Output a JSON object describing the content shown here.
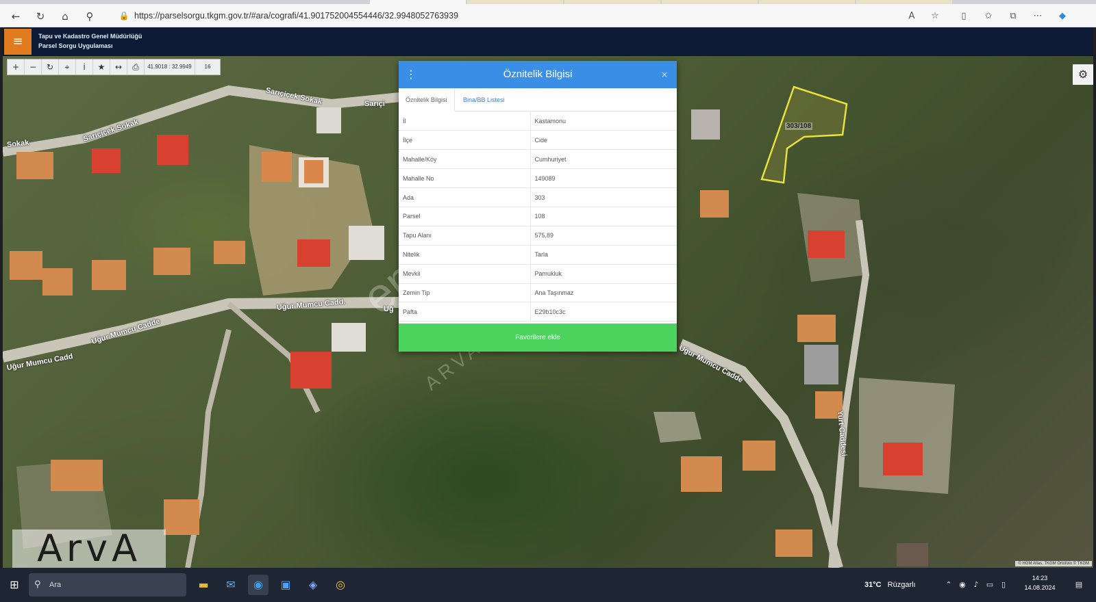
{
  "browser": {
    "url": "https://parselsorgu.tkgm.gov.tr/#ara/cografi/41.901752004554446/32.9948052763939",
    "icons": [
      "back-icon",
      "refresh-icon",
      "home-icon",
      "search-icon",
      "lock-icon",
      "read-aloud-icon",
      "favorite-star-icon",
      "split-view-icon",
      "favorites-icon",
      "collections-icon",
      "more-icon",
      "copilot-icon"
    ]
  },
  "app": {
    "menu_icon": "≡",
    "title_line1": "Tapu ve Kadastro Genel Müdürlüğü",
    "title_line2": "Parsel Sorgu Uygulaması"
  },
  "map": {
    "toolbar": {
      "coords": "41.9018 : 32.9949",
      "zoom": "16"
    },
    "road_labels": {
      "sanguj1": "Sarıçiçek Sokak",
      "sanguj2": "Sarıçiçek Sokak",
      "sanguj3": "Sarıçi",
      "sokak": "Sokak",
      "mumcu1": "Uğur Mumcu Cadd.",
      "mumcu2": "Uğur Mumcu Cadde",
      "mumcu3": "Uğur Mumcu Cadd",
      "mumcu4": "Uğur Mumcu Cadde",
      "mumcu5": "Uğ",
      "yurt": "Yurt Caddesi"
    },
    "parcel_label": "303/108",
    "attribution": "© HGM Atlas, TKGM Ortofoto © TKGM",
    "watermark": "emlakjet.com",
    "watermark2": "ARVA GAYRİMENKUL",
    "logo_text": "ArvA",
    "colors": {
      "parcel_outline": "#e8e23a",
      "dialog_header": "#3b8ee6",
      "favorite_button": "#4cd35e",
      "menu_button": "#e07c1d"
    }
  },
  "dialog": {
    "title": "Öznitelik Bilgisi",
    "close": "×",
    "tabs": [
      "Öznitelik Bilgisi",
      "Bina/BB Listesi"
    ],
    "rows": [
      {
        "key": "İl",
        "value": "Kastamonu"
      },
      {
        "key": "İlçe",
        "value": "Cide"
      },
      {
        "key": "Mahalle/Köy",
        "value": "Cumhuriyet"
      },
      {
        "key": "Mahalle No",
        "value": "149089"
      },
      {
        "key": "Ada",
        "value": "303"
      },
      {
        "key": "Parsel",
        "value": "108"
      },
      {
        "key": "Tapu Alanı",
        "value": "575,89"
      },
      {
        "key": "Nitelik",
        "value": "Tarla"
      },
      {
        "key": "Mevkii",
        "value": "Pamukluk"
      },
      {
        "key": "Zemin Tip",
        "value": "Ana Taşınmaz"
      },
      {
        "key": "Pafta",
        "value": "E29b10c3c"
      }
    ],
    "favorite_button": "Favorilere ekle"
  },
  "taskbar": {
    "search_text": "Ara",
    "weather_temp": "31°C",
    "weather_text": "Rüzgarlı",
    "time": "14:23",
    "date": "14.08.2024"
  }
}
